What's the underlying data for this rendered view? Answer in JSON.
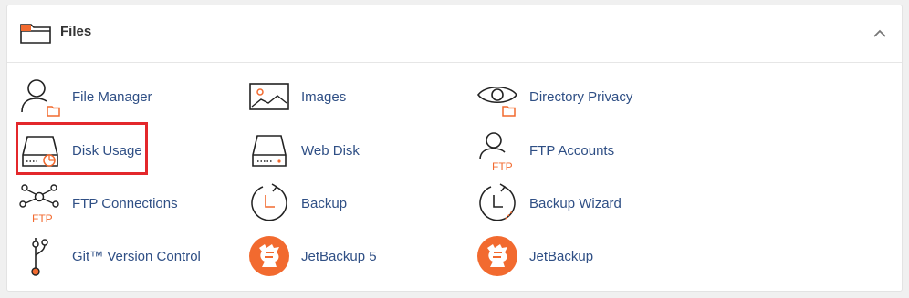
{
  "section": {
    "title": "Files",
    "icon": "folder-icon",
    "collapse_icon": "chevron-up-icon"
  },
  "colors": {
    "link": "#2f4f85",
    "accent": "#f26a2f",
    "highlight": "#e3272b"
  },
  "items": [
    {
      "label": "File Manager",
      "icon": "file-manager-icon"
    },
    {
      "label": "Images",
      "icon": "images-icon"
    },
    {
      "label": "Directory Privacy",
      "icon": "directory-privacy-icon"
    },
    {
      "label": "Disk Usage",
      "icon": "disk-usage-icon"
    },
    {
      "label": "Web Disk",
      "icon": "web-disk-icon"
    },
    {
      "label": "FTP Accounts",
      "icon": "ftp-accounts-icon"
    },
    {
      "label": "FTP Connections",
      "icon": "ftp-connections-icon"
    },
    {
      "label": "Backup",
      "icon": "backup-icon"
    },
    {
      "label": "Backup Wizard",
      "icon": "backup-wizard-icon"
    },
    {
      "label": "Git™ Version Control",
      "icon": "git-icon"
    },
    {
      "label": "JetBackup 5",
      "icon": "jetbackup-5-icon"
    },
    {
      "label": "JetBackup",
      "icon": "jetbackup-icon"
    }
  ],
  "ftp_badge": "FTP"
}
